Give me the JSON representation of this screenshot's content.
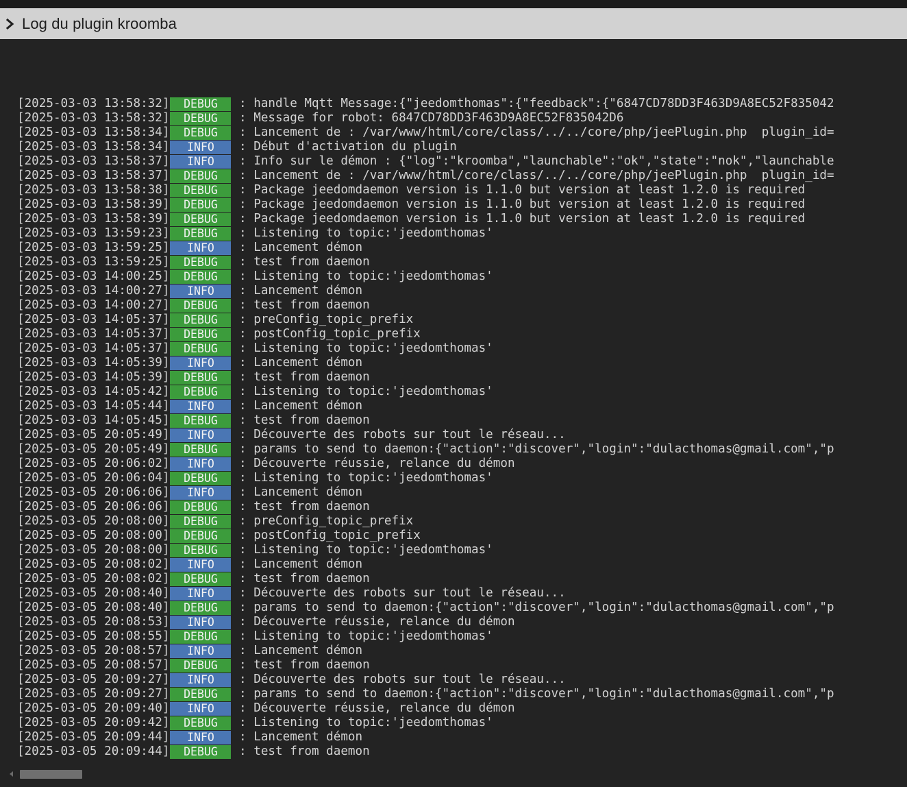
{
  "header": {
    "chevron_icon": "chevron-right-icon",
    "title": "Log du plugin kroomba"
  },
  "colors": {
    "debug": "#3c9c3c",
    "info": "#4a76b4"
  },
  "log": {
    "lines": [
      {
        "ts": "[2025-03-03 13:58:32]",
        "level": "DEBUG",
        "message": " : handle Mqtt Message:{\"jeedomthomas\":{\"feedback\":{\"6847CD78DD3F463D9A8EC52F835042"
      },
      {
        "ts": "[2025-03-03 13:58:32]",
        "level": "DEBUG",
        "message": " : Message for robot: 6847CD78DD3F463D9A8EC52F835042D6"
      },
      {
        "ts": "[2025-03-03 13:58:34]",
        "level": "DEBUG",
        "message": " : Lancement de : /var/www/html/core/class/../../core/php/jeePlugin.php  plugin_id="
      },
      {
        "ts": "[2025-03-03 13:58:34]",
        "level": "INFO",
        "message": " : Début d'activation du plugin"
      },
      {
        "ts": "[2025-03-03 13:58:37]",
        "level": "INFO",
        "message": " : Info sur le démon : {\"log\":\"kroomba\",\"launchable\":\"ok\",\"state\":\"nok\",\"launchable"
      },
      {
        "ts": "[2025-03-03 13:58:37]",
        "level": "DEBUG",
        "message": " : Lancement de : /var/www/html/core/class/../../core/php/jeePlugin.php  plugin_id="
      },
      {
        "ts": "[2025-03-03 13:58:38]",
        "level": "DEBUG",
        "message": " : Package jeedomdaemon version is 1.1.0 but version at least 1.2.0 is required"
      },
      {
        "ts": "[2025-03-03 13:58:39]",
        "level": "DEBUG",
        "message": " : Package jeedomdaemon version is 1.1.0 but version at least 1.2.0 is required"
      },
      {
        "ts": "[2025-03-03 13:58:39]",
        "level": "DEBUG",
        "message": " : Package jeedomdaemon version is 1.1.0 but version at least 1.2.0 is required"
      },
      {
        "ts": "[2025-03-03 13:59:23]",
        "level": "DEBUG",
        "message": " : Listening to topic:'jeedomthomas'"
      },
      {
        "ts": "[2025-03-03 13:59:25]",
        "level": "INFO",
        "message": " : Lancement démon"
      },
      {
        "ts": "[2025-03-03 13:59:25]",
        "level": "DEBUG",
        "message": " : test from daemon"
      },
      {
        "ts": "[2025-03-03 14:00:25]",
        "level": "DEBUG",
        "message": " : Listening to topic:'jeedomthomas'"
      },
      {
        "ts": "[2025-03-03 14:00:27]",
        "level": "INFO",
        "message": " : Lancement démon"
      },
      {
        "ts": "[2025-03-03 14:00:27]",
        "level": "DEBUG",
        "message": " : test from daemon"
      },
      {
        "ts": "[2025-03-03 14:05:37]",
        "level": "DEBUG",
        "message": " : preConfig_topic_prefix"
      },
      {
        "ts": "[2025-03-03 14:05:37]",
        "level": "DEBUG",
        "message": " : postConfig_topic_prefix"
      },
      {
        "ts": "[2025-03-03 14:05:37]",
        "level": "DEBUG",
        "message": " : Listening to topic:'jeedomthomas'"
      },
      {
        "ts": "[2025-03-03 14:05:39]",
        "level": "INFO",
        "message": " : Lancement démon"
      },
      {
        "ts": "[2025-03-03 14:05:39]",
        "level": "DEBUG",
        "message": " : test from daemon"
      },
      {
        "ts": "[2025-03-03 14:05:42]",
        "level": "DEBUG",
        "message": " : Listening to topic:'jeedomthomas'"
      },
      {
        "ts": "[2025-03-03 14:05:44]",
        "level": "INFO",
        "message": " : Lancement démon"
      },
      {
        "ts": "[2025-03-03 14:05:45]",
        "level": "DEBUG",
        "message": " : test from daemon"
      },
      {
        "ts": "[2025-03-05 20:05:49]",
        "level": "INFO",
        "message": " : Découverte des robots sur tout le réseau..."
      },
      {
        "ts": "[2025-03-05 20:05:49]",
        "level": "DEBUG",
        "message": " : params to send to daemon:{\"action\":\"discover\",\"login\":\"dulacthomas@gmail.com\",\"p"
      },
      {
        "ts": "[2025-03-05 20:06:02]",
        "level": "INFO",
        "message": " : Découverte réussie, relance du démon"
      },
      {
        "ts": "[2025-03-05 20:06:04]",
        "level": "DEBUG",
        "message": " : Listening to topic:'jeedomthomas'"
      },
      {
        "ts": "[2025-03-05 20:06:06]",
        "level": "INFO",
        "message": " : Lancement démon"
      },
      {
        "ts": "[2025-03-05 20:06:06]",
        "level": "DEBUG",
        "message": " : test from daemon"
      },
      {
        "ts": "[2025-03-05 20:08:00]",
        "level": "DEBUG",
        "message": " : preConfig_topic_prefix"
      },
      {
        "ts": "[2025-03-05 20:08:00]",
        "level": "DEBUG",
        "message": " : postConfig_topic_prefix"
      },
      {
        "ts": "[2025-03-05 20:08:00]",
        "level": "DEBUG",
        "message": " : Listening to topic:'jeedomthomas'"
      },
      {
        "ts": "[2025-03-05 20:08:02]",
        "level": "INFO",
        "message": " : Lancement démon"
      },
      {
        "ts": "[2025-03-05 20:08:02]",
        "level": "DEBUG",
        "message": " : test from daemon"
      },
      {
        "ts": "[2025-03-05 20:08:40]",
        "level": "INFO",
        "message": " : Découverte des robots sur tout le réseau..."
      },
      {
        "ts": "[2025-03-05 20:08:40]",
        "level": "DEBUG",
        "message": " : params to send to daemon:{\"action\":\"discover\",\"login\":\"dulacthomas@gmail.com\",\"p"
      },
      {
        "ts": "[2025-03-05 20:08:53]",
        "level": "INFO",
        "message": " : Découverte réussie, relance du démon"
      },
      {
        "ts": "[2025-03-05 20:08:55]",
        "level": "DEBUG",
        "message": " : Listening to topic:'jeedomthomas'"
      },
      {
        "ts": "[2025-03-05 20:08:57]",
        "level": "INFO",
        "message": " : Lancement démon"
      },
      {
        "ts": "[2025-03-05 20:08:57]",
        "level": "DEBUG",
        "message": " : test from daemon"
      },
      {
        "ts": "[2025-03-05 20:09:27]",
        "level": "INFO",
        "message": " : Découverte des robots sur tout le réseau..."
      },
      {
        "ts": "[2025-03-05 20:09:27]",
        "level": "DEBUG",
        "message": " : params to send to daemon:{\"action\":\"discover\",\"login\":\"dulacthomas@gmail.com\",\"p"
      },
      {
        "ts": "[2025-03-05 20:09:40]",
        "level": "INFO",
        "message": " : Découverte réussie, relance du démon"
      },
      {
        "ts": "[2025-03-05 20:09:42]",
        "level": "DEBUG",
        "message": " : Listening to topic:'jeedomthomas'"
      },
      {
        "ts": "[2025-03-05 20:09:44]",
        "level": "INFO",
        "message": " : Lancement démon"
      },
      {
        "ts": "[2025-03-05 20:09:44]",
        "level": "DEBUG",
        "message": " : test from daemon"
      }
    ]
  },
  "scrollbar": {
    "left_arrow_icon": "scroll-left-arrow-icon"
  }
}
